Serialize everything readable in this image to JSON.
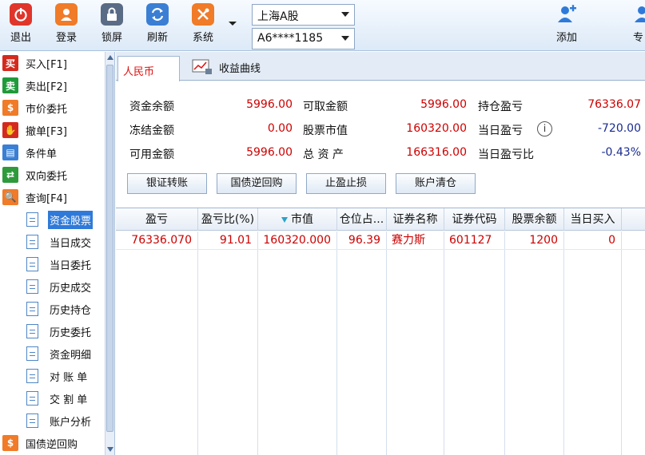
{
  "toolbar": {
    "buttons": [
      {
        "label": "退出",
        "icon": "power-icon",
        "color": "#e0352b"
      },
      {
        "label": "登录",
        "icon": "user-icon",
        "color": "#f07b28"
      },
      {
        "label": "锁屏",
        "icon": "lock-icon",
        "color": "#5a6b85"
      },
      {
        "label": "刷新",
        "icon": "refresh-icon",
        "color": "#3a7fd4"
      },
      {
        "label": "系统",
        "icon": "tools-icon",
        "color": "#f07b28"
      }
    ],
    "add_label": "添加",
    "partial_label": "专",
    "market_select": "上海A股",
    "account_select": "A6****1185"
  },
  "sidebar": {
    "top_items": [
      {
        "label": "买入[F1]",
        "icon_text": "买",
        "color": "#d42a1e"
      },
      {
        "label": "卖出[F2]",
        "icon_text": "卖",
        "color": "#1f9a3a"
      },
      {
        "label": "市价委托",
        "icon_text": "$",
        "color": "#f07b28"
      },
      {
        "label": "撤单[F3]",
        "icon_text": "✋",
        "color": "#d42a1e"
      },
      {
        "label": "条件单",
        "icon_text": "▤",
        "color": "#3a7fd4"
      },
      {
        "label": "双向委托",
        "icon_text": "⇄",
        "color": "#2e9a3c"
      },
      {
        "label": "查询[F4]",
        "icon_text": "🔍",
        "color": "#f07b28"
      }
    ],
    "sub_items": [
      "资金股票",
      "当日成交",
      "当日委托",
      "历史成交",
      "历史持仓",
      "历史委托",
      "资金明细",
      "对 账 单",
      "交 割 单",
      "账户分析"
    ],
    "active_sub": "资金股票",
    "bottom_item": "国债逆回购"
  },
  "tabs": {
    "rmb": "人民币",
    "curve": "收益曲线"
  },
  "summary": {
    "col1": [
      {
        "label": "资金余额",
        "value": "5996.00"
      },
      {
        "label": "冻结金额",
        "value": "0.00"
      },
      {
        "label": "可用金额",
        "value": "5996.00"
      }
    ],
    "col2": [
      {
        "label": "可取金额",
        "value": "5996.00"
      },
      {
        "label": "股票市值",
        "value": "160320.00"
      },
      {
        "label": "总 资 产",
        "value": "166316.00"
      }
    ],
    "col3": [
      {
        "label": "持仓盈亏",
        "value": "76336.07"
      },
      {
        "label": "当日盈亏",
        "value": "-720.00"
      },
      {
        "label": "当日盈亏比",
        "value": "-0.43%"
      }
    ]
  },
  "actions": [
    "银证转账",
    "国债逆回购",
    "止盈止损",
    "账户清仓"
  ],
  "table": {
    "headers": [
      "盈亏",
      "盈亏比(%)",
      "市值",
      "仓位占...",
      "证券名称",
      "证券代码",
      "股票余额",
      "当日买入"
    ],
    "rows": [
      [
        "76336.070",
        "91.01",
        "160320.000",
        "96.39",
        "赛力斯",
        "601127",
        "1200",
        "0"
      ]
    ]
  }
}
